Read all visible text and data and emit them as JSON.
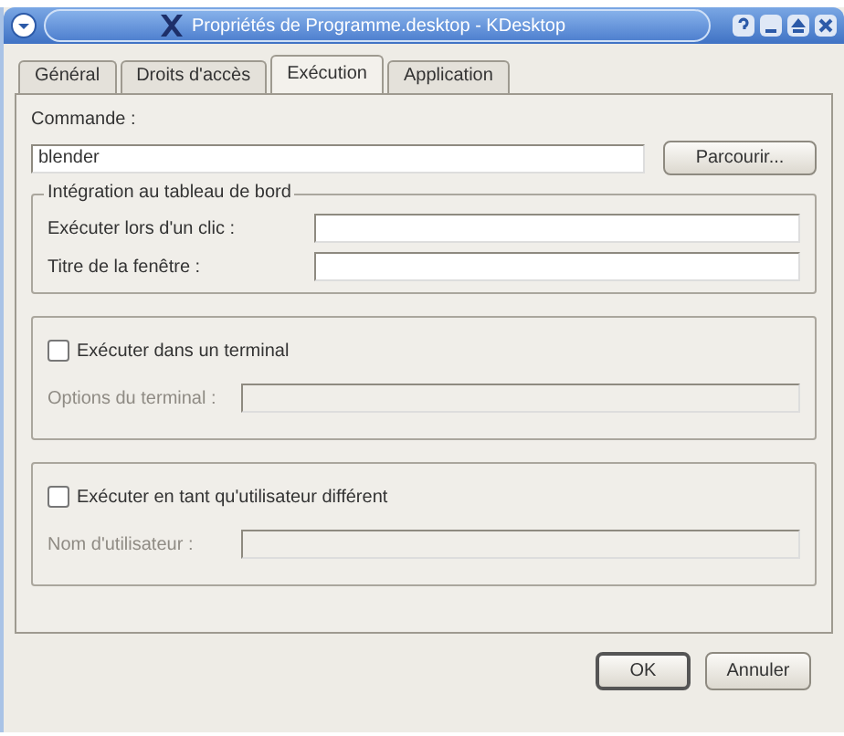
{
  "window": {
    "title": "Propriétés de Programme.desktop - KDesktop"
  },
  "tabs": [
    {
      "label": "Général",
      "selected": false
    },
    {
      "label": "Droits d'accès",
      "selected": false
    },
    {
      "label": "Exécution",
      "selected": true
    },
    {
      "label": "Application",
      "selected": false
    }
  ],
  "command": {
    "label": "Commande :",
    "value": "blender",
    "browse_button": "Parcourir..."
  },
  "panel_group": {
    "title": "Intégration au tableau de bord",
    "fields": [
      {
        "label": "Exécuter lors d'un clic :"
      },
      {
        "label": "Titre de la fenêtre :"
      }
    ]
  },
  "options": [
    {
      "checkbox": "Exécuter dans un terminal",
      "checked": false,
      "field_label": "Options du terminal :",
      "disabled": true
    },
    {
      "checkbox": "Exécuter en tant qu'utilisateur différent",
      "checked": false,
      "field_label": "Nom d'utilisateur :",
      "disabled": true
    }
  ],
  "buttons": [
    "OK",
    "Annuler"
  ]
}
